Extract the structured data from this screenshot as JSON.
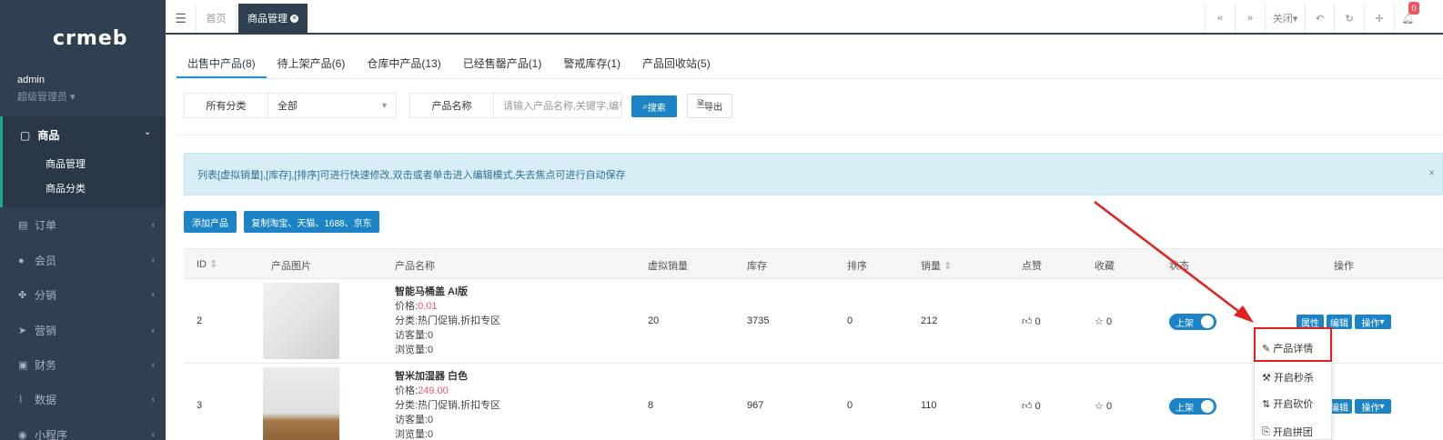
{
  "sidebar": {
    "logo": "crmeb",
    "admin_name": "admin",
    "admin_role": "超级管理员",
    "active_group": {
      "label": "商品",
      "items": [
        "商品管理",
        "商品分类"
      ]
    },
    "items": [
      {
        "label": "订单",
        "icon": "clipboard-icon"
      },
      {
        "label": "会员",
        "icon": "user-icon"
      },
      {
        "label": "分销",
        "icon": "network-icon"
      },
      {
        "label": "营销",
        "icon": "send-icon"
      },
      {
        "label": "财务",
        "icon": "money-icon"
      },
      {
        "label": "数据",
        "icon": "chart-icon"
      },
      {
        "label": "小程序",
        "icon": "app-icon"
      }
    ]
  },
  "topbar": {
    "home_tab": "首页",
    "active_tab": "商品管理",
    "close_label": "关闭",
    "badge_count": "0"
  },
  "subtabs": [
    "出售中产品(8)",
    "待上架产品(6)",
    "仓库中产品(13)",
    "已经售罄产品(1)",
    "警戒库存(1)",
    "产品回收站(5)"
  ],
  "filters": {
    "category_label": "所有分类",
    "category_value": "全部",
    "name_label": "产品名称",
    "name_placeholder": "请输入产品名称,关键字,编号",
    "search_button": "搜索",
    "export_button": "导出"
  },
  "alert": {
    "text": "列表[虚拟销量],[库存],[排序]可进行快速修改,双击或者单击进入编辑模式,失去焦点可进行自动保存",
    "close": "×"
  },
  "actions": {
    "add_product": "添加产品",
    "copy_product": "复制淘宝、天猫、1688、京东"
  },
  "table": {
    "headers": [
      "ID",
      "产品图片",
      "产品名称",
      "虚拟销量",
      "库存",
      "排序",
      "销量",
      "点赞",
      "收藏",
      "状态",
      "操作"
    ],
    "rows": [
      {
        "id": "2",
        "name": "智能马桶盖 AI版",
        "price_label": "价格:",
        "price": "0.01",
        "category": "分类:热门促销,折扣专区",
        "visitors": "访客量:0",
        "views": "浏览量:0",
        "virtual_sales": "20",
        "stock": "3735",
        "sort": "0",
        "sales": "212",
        "likes": "0",
        "favorites": "0",
        "status": "上架"
      },
      {
        "id": "3",
        "name": "智米加湿器 白色",
        "price_label": "价格:",
        "price": "249.00",
        "category": "分类:热门促销,折扣专区",
        "visitors": "访客量:0",
        "views": "浏览量:0",
        "virtual_sales": "8",
        "stock": "967",
        "sort": "0",
        "sales": "110",
        "likes": "0",
        "favorites": "0",
        "status": "上架"
      }
    ],
    "row_buttons": {
      "attr": "属性",
      "edit": "编辑",
      "ops": "操作"
    }
  },
  "dropdown": {
    "items": [
      "产品详情",
      "开启秒杀",
      "开启砍价",
      "开启拼团"
    ]
  },
  "colors": {
    "sidebar": "#2f4050",
    "primary": "#1c84c6",
    "highlight": "#e02020"
  }
}
